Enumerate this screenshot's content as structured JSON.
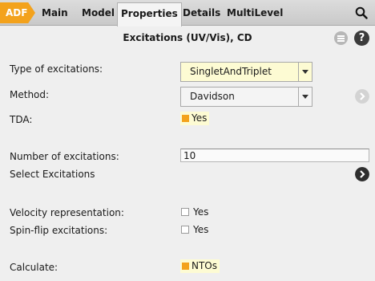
{
  "tabs": {
    "adf": "ADF",
    "main": "Main",
    "model": "Model",
    "properties": "Properties",
    "details": "Details",
    "multilevel": "MultiLevel"
  },
  "panel": {
    "title": "Excitations (UV/Vis), CD"
  },
  "fields": {
    "type_label": "Type of excitations:",
    "type_value": "SingletAndTriplet",
    "method_label": "Method:",
    "method_value": "Davidson",
    "tda_label": "TDA:",
    "tda_value": "Yes",
    "num_label": "Number of excitations:",
    "num_value": "10",
    "select_label": "Select Excitations",
    "velocity_label": "Velocity representation:",
    "velocity_value": "Yes",
    "spinflip_label": "Spin-flip excitations:",
    "spinflip_value": "Yes",
    "calculate_label": "Calculate:",
    "calculate_value": "NTOs"
  },
  "colors": {
    "accent": "#f3a21c",
    "highlight": "#fdfbd3",
    "background": "#efefef"
  },
  "icons": [
    "search-icon",
    "menu-icon",
    "help-icon",
    "chevron-right-icon"
  ]
}
